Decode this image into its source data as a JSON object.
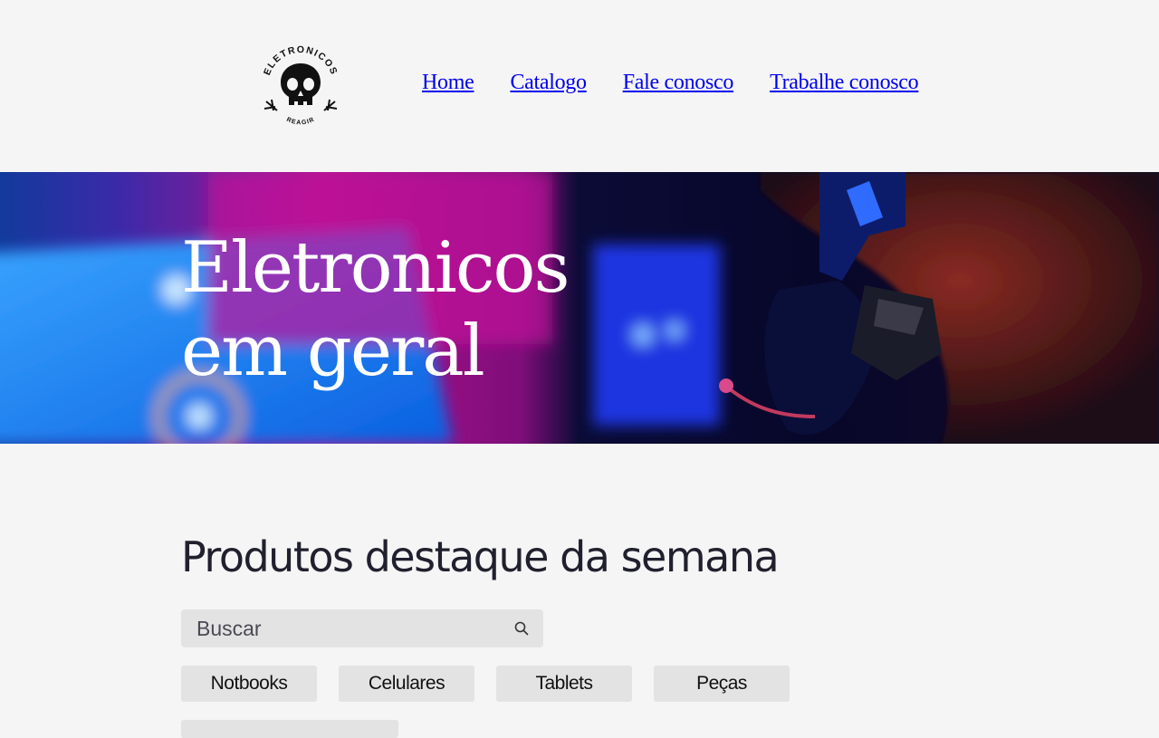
{
  "header": {
    "logo": {
      "top_text": "ELETRONICOS",
      "bottom_text": "REAGIR",
      "icon": "skull-logo"
    },
    "nav": [
      {
        "label": "Home"
      },
      {
        "label": "Catalogo"
      },
      {
        "label": "Fale conosco"
      },
      {
        "label": "Trabalhe conosco"
      }
    ]
  },
  "hero": {
    "title_line1": "Eletronicos",
    "title_line2": "em geral"
  },
  "featured": {
    "title": "Produtos destaque da semana",
    "search_placeholder": "Buscar",
    "search_icon": "search-icon",
    "categories": [
      {
        "label": "Notbooks"
      },
      {
        "label": "Celulares"
      },
      {
        "label": "Tablets"
      },
      {
        "label": "Peças"
      }
    ]
  },
  "colors": {
    "background": "#f5f5f5",
    "link": "#0000ee",
    "heading": "#20202e",
    "chip": "#e3e3e3"
  }
}
